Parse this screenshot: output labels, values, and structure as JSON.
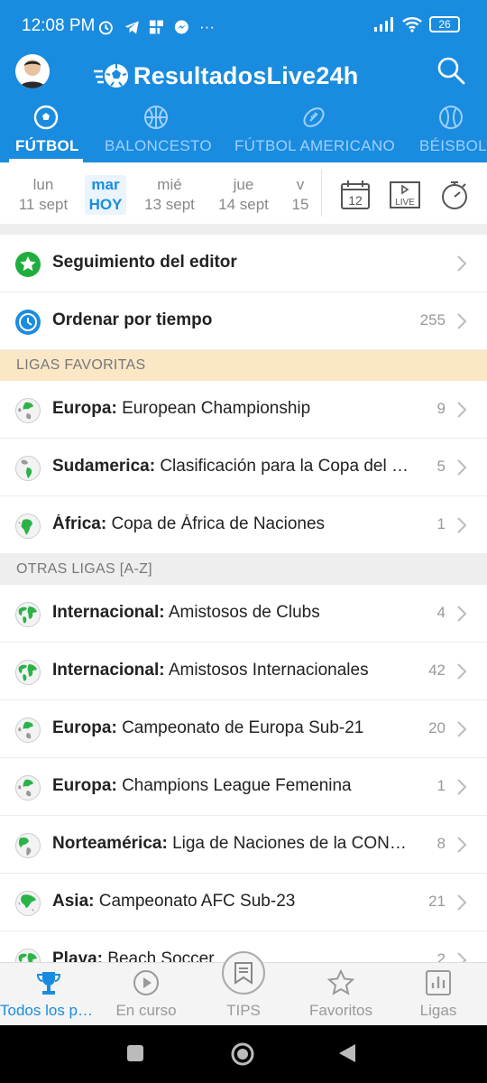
{
  "status_bar": {
    "time": "12:08 PM",
    "dots": "···",
    "battery": "26"
  },
  "app": {
    "logo_text": "ResultadosLive24h"
  },
  "sport_tabs": [
    {
      "label": "FÚTBOL",
      "icon": "soccer-ball-icon",
      "active": true
    },
    {
      "label": "BALONCESTO",
      "icon": "basketball-icon",
      "active": false
    },
    {
      "label": "FÚTBOL AMERICANO",
      "icon": "american-football-icon",
      "active": false
    },
    {
      "label": "BÉISBOL",
      "icon": "baseball-icon",
      "active": false
    }
  ],
  "dates": [
    {
      "day": "lun",
      "date": "11 sept"
    },
    {
      "day": "mar",
      "date": "HOY",
      "today": true
    },
    {
      "day": "mié",
      "date": "13 sept"
    },
    {
      "day": "jue",
      "date": "14 sept"
    },
    {
      "day": "v",
      "date": "15"
    }
  ],
  "date_actions": {
    "calendar_day": "12",
    "live_label": "LIVE"
  },
  "top_rows": [
    {
      "label": "Seguimiento del editor",
      "count": "",
      "icon": "star-circle-icon"
    },
    {
      "label": "Ordenar por tiempo",
      "count": "255",
      "icon": "clock-circle-icon"
    }
  ],
  "sections": {
    "favorites": "LIGAS FAVORITAS",
    "others": "OTRAS LIGAS [A-Z]"
  },
  "favorite_leagues": [
    {
      "region": "Europa:",
      "name": "European Championship",
      "count": "9",
      "icon": "globe-europe-icon"
    },
    {
      "region": "Sudamerica:",
      "name": "Clasificación para la Copa del Mundo",
      "count": "5",
      "icon": "globe-americas-icon"
    },
    {
      "region": "África:",
      "name": "Copa de África de Naciones",
      "count": "1",
      "icon": "globe-africa-icon"
    }
  ],
  "other_leagues": [
    {
      "region": "Internacional:",
      "name": "Amistosos de Clubs",
      "count": "4",
      "icon": "globe-world-icon"
    },
    {
      "region": "Internacional:",
      "name": "Amistosos Internacionales",
      "count": "42",
      "icon": "globe-world-icon"
    },
    {
      "region": "Europa:",
      "name": "Campeonato de Europa Sub-21",
      "count": "20",
      "icon": "globe-europe-icon"
    },
    {
      "region": "Europa:",
      "name": "Champions League Femenina",
      "count": "1",
      "icon": "globe-europe-icon"
    },
    {
      "region": "Norteamérica:",
      "name": "Liga de Naciones de la CONCACAF",
      "count": "8",
      "icon": "globe-americas-icon"
    },
    {
      "region": "Asia:",
      "name": "Campeonato AFC Sub-23",
      "count": "21",
      "icon": "globe-asia-icon"
    },
    {
      "region": "Playa:",
      "name": "Beach Soccer",
      "count": "2",
      "icon": "globe-world-icon"
    }
  ],
  "bottom_nav": [
    {
      "label": "Todos los partidos",
      "icon": "trophy-icon",
      "active": true
    },
    {
      "label": "En curso",
      "icon": "play-circle-icon",
      "active": false
    },
    {
      "label": "TIPS",
      "icon": "tips-bookmark-icon",
      "active": false
    },
    {
      "label": "Favoritos",
      "icon": "star-outline-icon",
      "active": false
    },
    {
      "label": "Ligas",
      "icon": "leagues-chart-icon",
      "active": false
    }
  ],
  "colors": {
    "brand_blue": "#1a8cdf",
    "favorites_band": "#fbe7c6",
    "star_green": "#1fae3d",
    "globe_green": "#2bb34a"
  }
}
